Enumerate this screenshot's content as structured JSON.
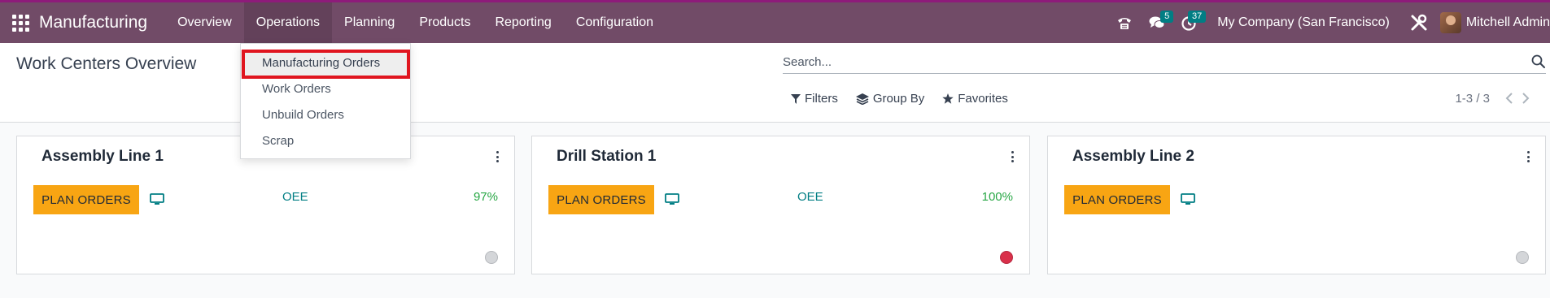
{
  "navbar": {
    "brand": "Manufacturing",
    "menu": [
      "Overview",
      "Operations",
      "Planning",
      "Products",
      "Reporting",
      "Configuration"
    ],
    "active_menu": "Operations",
    "messages_count": "5",
    "activities_count": "37",
    "company": "My Company (San Francisco)",
    "user": "Mitchell Admin",
    "accent_color": "#714b67",
    "badge_color": "#017e84"
  },
  "control_panel": {
    "title": "Work Centers Overview",
    "search_placeholder": "Search...",
    "filters_label": "Filters",
    "group_by_label": "Group By",
    "favorites_label": "Favorites",
    "pager": "1-3 / 3"
  },
  "dropdown": {
    "items": [
      "Manufacturing Orders",
      "Work Orders",
      "Unbuild Orders",
      "Scrap"
    ],
    "highlighted": "Manufacturing Orders"
  },
  "cards": [
    {
      "title": "Assembly Line 1",
      "button": "PLAN ORDERS",
      "oee_label": "OEE",
      "oee_value": "97%",
      "status": "grey"
    },
    {
      "title": "Drill Station 1",
      "button": "PLAN ORDERS",
      "oee_label": "OEE",
      "oee_value": "100%",
      "status": "red"
    },
    {
      "title": "Assembly Line 2",
      "button": "PLAN ORDERS",
      "oee_label": "",
      "oee_value": "",
      "status": "grey"
    }
  ],
  "icons": {
    "apps": "apps-grid-icon",
    "phone": "phone-icon",
    "messages": "chat-icon",
    "activities": "clock-icon",
    "tools": "tools-icon",
    "search": "search-icon",
    "filter": "filter-icon",
    "group_by": "layers-icon",
    "favorites": "star-icon",
    "card_menu": "kebab-menu-icon",
    "monitor": "monitor-icon"
  }
}
